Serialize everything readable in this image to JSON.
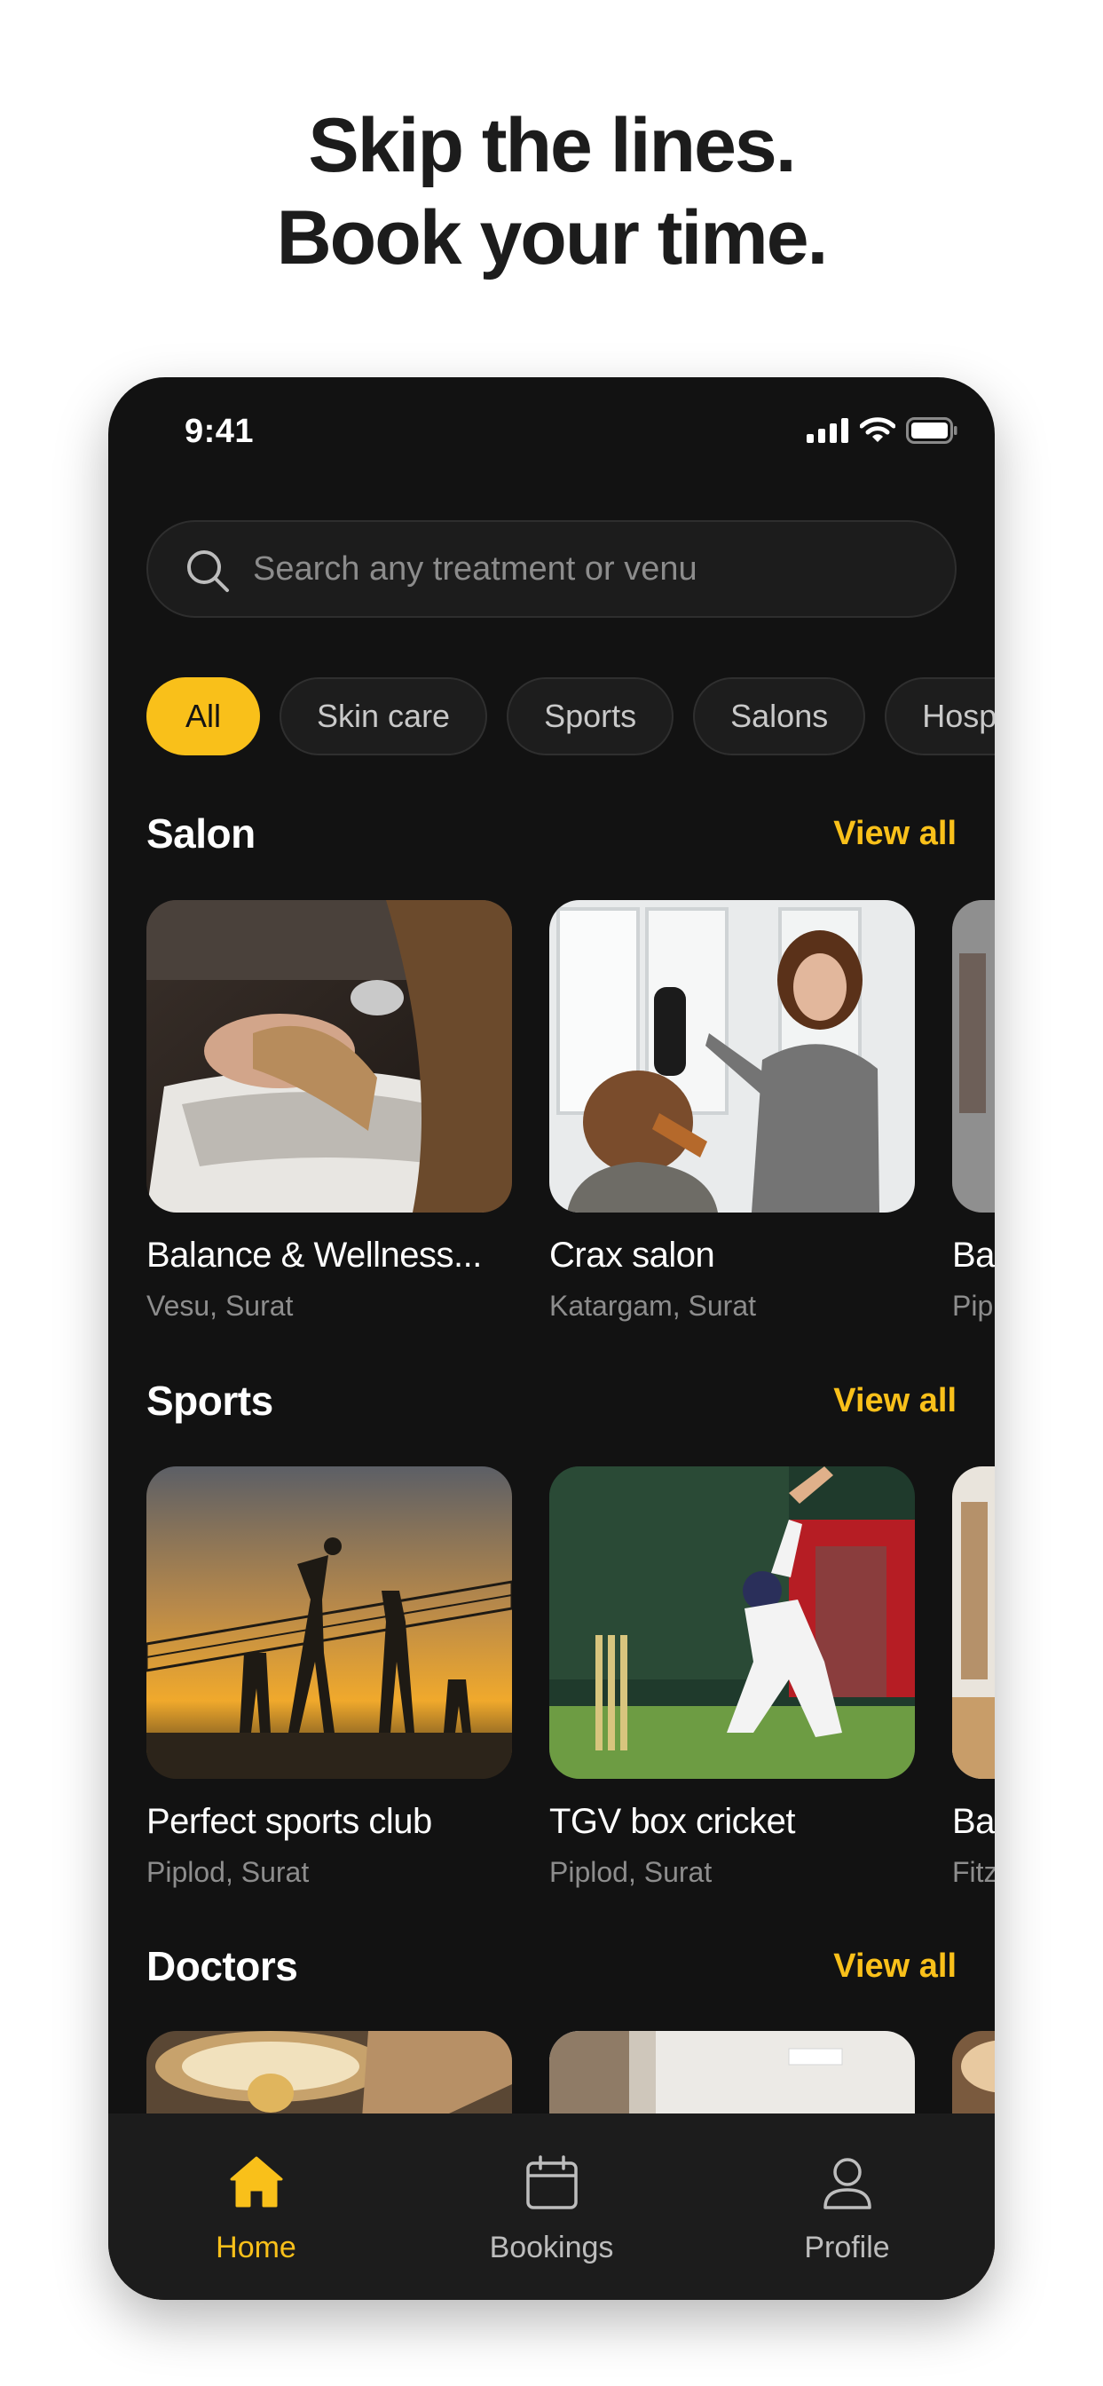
{
  "headline": {
    "line1": "Skip the lines.",
    "line2": "Book your time."
  },
  "status_bar": {
    "time": "9:41"
  },
  "search": {
    "placeholder": "Search any treatment or venu"
  },
  "categories": [
    {
      "label": "All",
      "active": true
    },
    {
      "label": "Skin care"
    },
    {
      "label": "Sports"
    },
    {
      "label": "Salons"
    },
    {
      "label": "Hosp"
    }
  ],
  "sections": [
    {
      "title": "Salon",
      "view_all": "View all",
      "venues": [
        {
          "name": "Balance & Wellness...",
          "location": "Vesu, Surat"
        },
        {
          "name": "Crax salon",
          "location": "Katargam, Surat"
        },
        {
          "name": "Bal",
          "location": "Pip"
        }
      ]
    },
    {
      "title": "Sports",
      "view_all": "View all",
      "venues": [
        {
          "name": "Perfect sports club",
          "location": "Piplod, Surat"
        },
        {
          "name": "TGV box cricket",
          "location": "Piplod, Surat"
        },
        {
          "name": "Bal",
          "location": "Fitz"
        }
      ]
    },
    {
      "title": "Doctors",
      "view_all": "View all"
    }
  ],
  "tab_bar": [
    {
      "label": "Home",
      "icon": "home-icon",
      "active": true
    },
    {
      "label": "Bookings",
      "icon": "calendar-icon"
    },
    {
      "label": "Profile",
      "icon": "user-icon"
    }
  ],
  "colors": {
    "accent": "#F9C01A",
    "background": "#121212",
    "surface": "#1C1C1C"
  }
}
